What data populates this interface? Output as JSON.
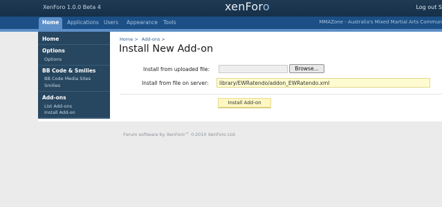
{
  "topbar": {
    "app_title": "XenForo 1.0.0 Beta 4",
    "logo_main": "xenFor",
    "logo_tail": "o",
    "logout": "Log out S"
  },
  "tabs": [
    {
      "label": "Home",
      "active": true
    },
    {
      "label": "Applications"
    },
    {
      "label": "Users"
    },
    {
      "label": "Appearance"
    },
    {
      "label": "Tools"
    }
  ],
  "site_name": "MMAZone - Australia's Mixed Martial Arts Commun",
  "sidebar": {
    "home": "Home",
    "options_heading": "Options",
    "options_link": "Options",
    "bbcode_heading": "BB Code & Smilies",
    "bbcode_media": "BB Code Media Sites",
    "smilies": "Smilies",
    "addons_heading": "Add-ons",
    "list_addons": "List Add-ons",
    "install_addon": "Install Add-on"
  },
  "breadcrumb": {
    "home": "Home >",
    "addons": "Add-ons >"
  },
  "page_title": "Install New Add-on",
  "form": {
    "upload_label": "Install from uploaded file:",
    "browse_label": "Browse...",
    "server_label": "Install from file on server:",
    "server_value": "library/EWRatendo/addon_EWRatendo.xml",
    "submit_label": "Install Add-on"
  },
  "footer": "Forum software by XenForo™ ©2010 XenForo Ltd.",
  "colors": {
    "topbar": "#1f3a52",
    "tabbar": "#1b4f85",
    "active_tab": "#5d8fc8",
    "sidebar": "#27465f",
    "input_highlight": "#fffbd0"
  }
}
